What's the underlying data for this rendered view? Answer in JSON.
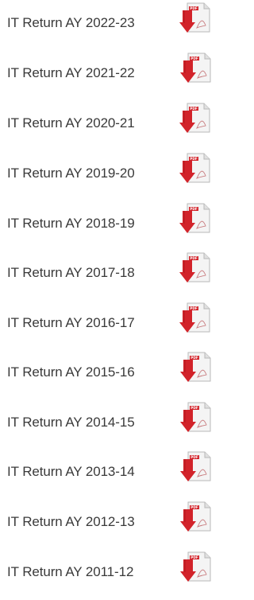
{
  "colors": {
    "text": "#3a3a3a",
    "pdf_red": "#d2232a",
    "pdf_dark_red": "#a4161c"
  },
  "returns": [
    {
      "label": "IT Return AY 2022-23",
      "icon": "pdf-download-icon"
    },
    {
      "label": "IT Return AY 2021-22",
      "icon": "pdf-download-icon"
    },
    {
      "label": "IT Return AY 2020-21",
      "icon": "pdf-download-icon"
    },
    {
      "label": "IT Return AY 2019-20",
      "icon": "pdf-download-icon"
    },
    {
      "label": "IT Return AY 2018-19",
      "icon": "pdf-download-icon"
    },
    {
      "label": "IT Return AY 2017-18",
      "icon": "pdf-download-icon"
    },
    {
      "label": "IT Return AY 2016-17",
      "icon": "pdf-download-icon"
    },
    {
      "label": "IT Return AY 2015-16",
      "icon": "pdf-download-icon"
    },
    {
      "label": "IT Return AY 2014-15",
      "icon": "pdf-download-icon"
    },
    {
      "label": "IT Return AY 2013-14",
      "icon": "pdf-download-icon"
    },
    {
      "label": "IT Return AY 2012-13",
      "icon": "pdf-download-icon"
    },
    {
      "label": "IT Return AY 2011-12",
      "icon": "pdf-download-icon"
    }
  ]
}
